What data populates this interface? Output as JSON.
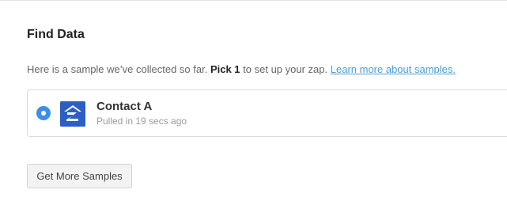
{
  "section": {
    "title": "Find Data"
  },
  "intro": {
    "prefix": "Here is a sample we’ve collected so far.",
    "emphasis": "Pick 1",
    "suffix": "to set up your zap.",
    "link_text": "Learn more about samples."
  },
  "samples": [
    {
      "title": "Contact A",
      "subtitle": "Pulled in 19 secs ago",
      "selected": true,
      "app_icon": "zillow-icon"
    }
  ],
  "actions": {
    "get_more_label": "Get More Samples"
  },
  "colors": {
    "accent": "#3d8fe6",
    "link": "#4a9fd8",
    "app_brand": "#2c5ec4"
  }
}
